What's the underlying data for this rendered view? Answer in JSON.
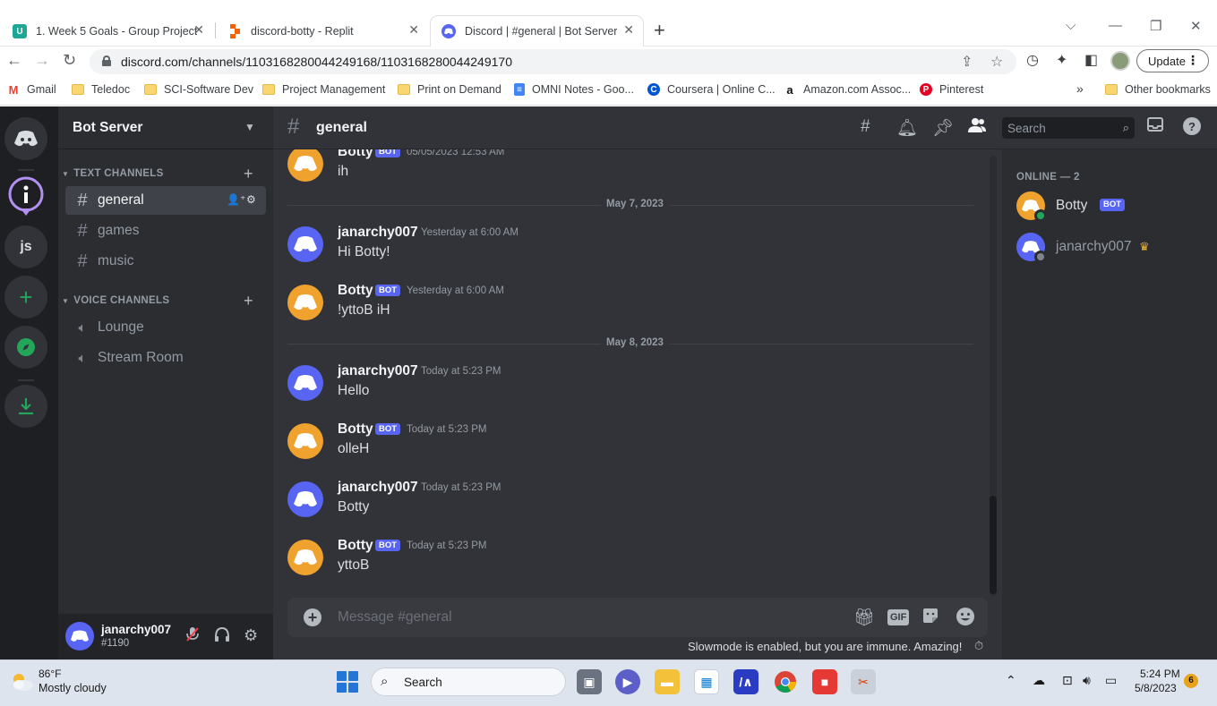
{
  "browser": {
    "tabs": [
      {
        "title": "1. Week 5 Goals - Group Project",
        "favicon": "U",
        "favicon_color": "#1ea697",
        "active": false
      },
      {
        "title": "discord-botty - Replit",
        "favicon": "replit",
        "favicon_color": "#f26207",
        "active": false
      },
      {
        "title": "Discord | #general | Bot Server",
        "favicon": "discord",
        "favicon_color": "#5865f2",
        "active": true
      }
    ],
    "url": "discord.com/channels/1103168280044249168/1103168280044249170",
    "update_label": "Update",
    "bookmarks": [
      {
        "label": "Gmail",
        "icon": "gmail-icon"
      },
      {
        "label": "Teledoc",
        "icon": "folder-icon"
      },
      {
        "label": "SCI-Software Dev",
        "icon": "folder-icon"
      },
      {
        "label": "Project Management",
        "icon": "folder-icon"
      },
      {
        "label": "Print on Demand",
        "icon": "folder-icon"
      },
      {
        "label": "OMNI Notes - Goo...",
        "icon": "docs-icon"
      },
      {
        "label": "Coursera | Online C...",
        "icon": "coursera-icon"
      },
      {
        "label": "Amazon.com Assoc...",
        "icon": "amazon-icon"
      },
      {
        "label": "Pinterest",
        "icon": "pinterest-icon"
      }
    ],
    "bookmarks_overflow": "»",
    "other_bookmarks": "Other bookmarks"
  },
  "discord": {
    "server_name": "Bot Server",
    "guilds": [
      "discord-home",
      "i",
      "js",
      "add-server",
      "explore",
      "download"
    ],
    "text_category": "TEXT CHANNELS",
    "voice_category": "VOICE CHANNELS",
    "text_channels": [
      "general",
      "games",
      "music"
    ],
    "voice_channels": [
      "Lounge",
      "Stream Room"
    ],
    "active_channel": "general",
    "user": {
      "name": "janarchy007",
      "tag": "#1190"
    },
    "search_placeholder": "Search",
    "messages": [
      {
        "author": "Botty",
        "bot": true,
        "time": "05/05/2023 12:53 AM",
        "text": "ih"
      },
      {
        "divider": "May 7, 2023"
      },
      {
        "author": "janarchy007",
        "bot": false,
        "time": "Yesterday at 6:00 AM",
        "text": "Hi Botty!"
      },
      {
        "author": "Botty",
        "bot": true,
        "time": "Yesterday at 6:00 AM",
        "text": "!yttoB iH"
      },
      {
        "divider": "May 8, 2023"
      },
      {
        "author": "janarchy007",
        "bot": false,
        "time": "Today at 5:23 PM",
        "text": "Hello"
      },
      {
        "author": "Botty",
        "bot": true,
        "time": "Today at 5:23 PM",
        "text": "olleH"
      },
      {
        "author": "janarchy007",
        "bot": false,
        "time": "Today at 5:23 PM",
        "text": "Botty"
      },
      {
        "author": "Botty",
        "bot": true,
        "time": "Today at 5:23 PM",
        "text": "yttoB"
      }
    ],
    "bot_badge": "BOT",
    "composer_placeholder": "Message #general",
    "gif_label": "GIF",
    "slowmode_notice": "Slowmode is enabled, but you are immune. Amazing!",
    "online_label": "ONLINE — 2",
    "members": [
      {
        "name": "Botty",
        "bot": true,
        "status_color": "#23a55a"
      },
      {
        "name": "janarchy007",
        "bot": false,
        "owner": true,
        "status_color": "#80848e"
      }
    ],
    "colors": {
      "blurple": "#5865f2",
      "bot_avatar": "#f0a22e",
      "bg": "#313338"
    }
  },
  "taskbar": {
    "weather_temp": "86°F",
    "weather_desc": "Mostly cloudy",
    "search_label": "Search",
    "time": "5:24 PM",
    "date": "5/8/2023",
    "notifications": "6"
  }
}
